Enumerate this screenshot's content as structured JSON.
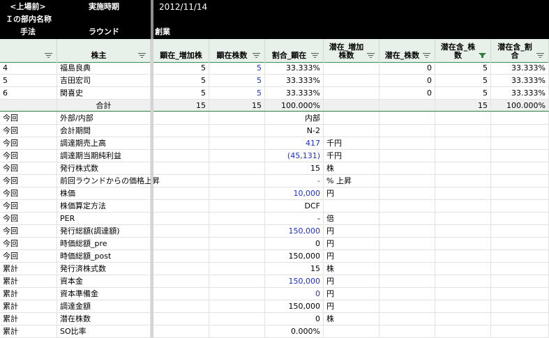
{
  "top": {
    "r1": [
      "<上場前>",
      "実施時期",
      "2012/11/14"
    ],
    "r2": [
      "Ｉの部内名称"
    ],
    "r3": [
      "手法",
      "ラウンド",
      "創業"
    ]
  },
  "headers": [
    {
      "label": "",
      "filter": true
    },
    {
      "label": "株主",
      "filter": true
    },
    {
      "label": "顕在_増加株",
      "filter": false
    },
    {
      "label": "顕在株数",
      "filter": true
    },
    {
      "label": "割合_顕在",
      "filter": true
    },
    {
      "label": "潜在_増加\n株数",
      "filter": true
    },
    {
      "label": "潜在_株数",
      "filter": true
    },
    {
      "label": "潜在含_株\n数",
      "filter": true,
      "active": true
    },
    {
      "label": "潜在含_割\n合",
      "filter": true
    }
  ],
  "shareholders": [
    {
      "no": "4",
      "name": "福島良典",
      "inc": "5",
      "shares": "5",
      "ratio": "33.333%",
      "pot_inc": "",
      "pot": "0",
      "incl": "5",
      "incl_ratio": "33.333%"
    },
    {
      "no": "5",
      "name": "吉田宏司",
      "inc": "5",
      "shares": "5",
      "ratio": "33.333%",
      "pot_inc": "",
      "pot": "0",
      "incl": "5",
      "incl_ratio": "33.333%"
    },
    {
      "no": "6",
      "name": "関喜史",
      "inc": "5",
      "shares": "5",
      "ratio": "33.333%",
      "pot_inc": "",
      "pot": "0",
      "incl": "5",
      "incl_ratio": "33.333%"
    }
  ],
  "total": {
    "label": "合計",
    "inc": "15",
    "shares": "15",
    "ratio": "100.000%",
    "incl": "15",
    "incl_ratio": "100.000%"
  },
  "details": [
    {
      "a": "今回",
      "b": "外部/内部",
      "v": "内部",
      "u": "",
      "blue": false
    },
    {
      "a": "今回",
      "b": "会計期間",
      "v": "N-2",
      "u": "",
      "blue": false
    },
    {
      "a": "今回",
      "b": "調達期売上高",
      "v": "417",
      "u": "千円",
      "blue": true
    },
    {
      "a": "今回",
      "b": "調達期当期純利益",
      "v": "(45,131)",
      "u": "千円",
      "blue": true
    },
    {
      "a": "今回",
      "b": "発行株式数",
      "v": "15",
      "u": "株",
      "blue": false
    },
    {
      "a": "今回",
      "b": "前回ラウンドからの価格上昇",
      "v": "-",
      "u": "% 上昇",
      "blue": true
    },
    {
      "a": "今回",
      "b": "株価",
      "v": "10,000",
      "u": "円",
      "blue": true
    },
    {
      "a": "今回",
      "b": "株価算定方法",
      "v": "DCF",
      "u": "",
      "blue": false
    },
    {
      "a": "今回",
      "b": "PER",
      "v": "-",
      "u": "倍",
      "blue": false
    },
    {
      "a": "今回",
      "b": "発行総額(調達額)",
      "v": "150,000",
      "u": "円",
      "blue": true
    },
    {
      "a": "今回",
      "b": "時価総額_pre",
      "v": "0",
      "u": "円",
      "blue": false
    },
    {
      "a": "今回",
      "b": "時価総額_post",
      "v": "150,000",
      "u": "円",
      "blue": false
    },
    {
      "a": "累計",
      "b": "発行済株式数",
      "v": "15",
      "u": "株",
      "blue": false
    },
    {
      "a": "累計",
      "b": "資本金",
      "v": "150,000",
      "u": "円",
      "blue": true
    },
    {
      "a": "累計",
      "b": "資本準備金",
      "v": "0",
      "u": "円",
      "blue": true
    },
    {
      "a": "累計",
      "b": "調達金額",
      "v": "150,000",
      "u": "円",
      "blue": false
    },
    {
      "a": "累計",
      "b": "潜在株数",
      "v": "0",
      "u": "株",
      "blue": false
    },
    {
      "a": "累計",
      "b": "SO比率",
      "v": "0.000%",
      "u": "",
      "blue": false
    }
  ]
}
